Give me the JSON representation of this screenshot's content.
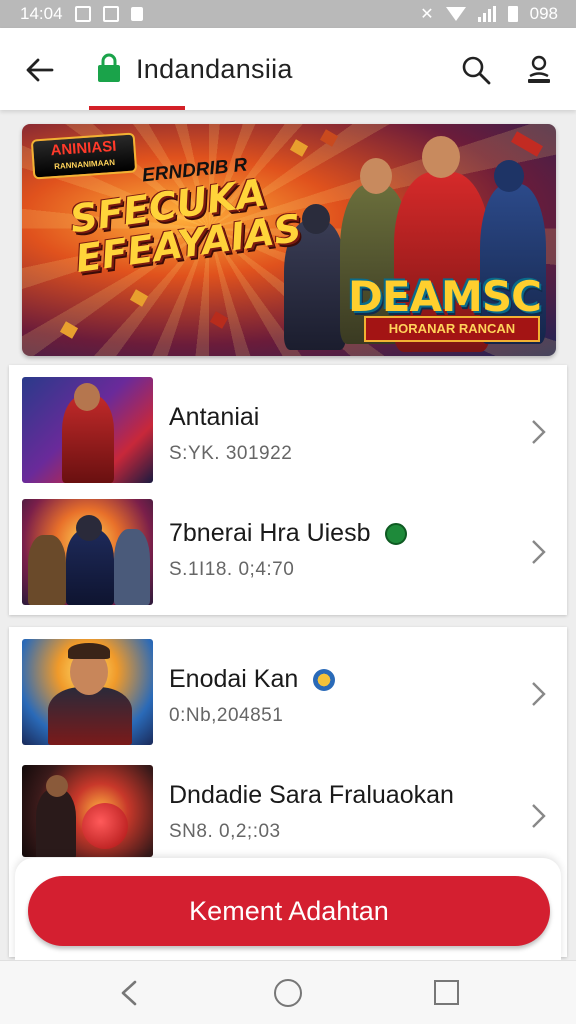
{
  "status_bar": {
    "time": "14:04",
    "battery": "098",
    "icons": [
      "sim-icon",
      "photo-icon",
      "notification-icon",
      "mute-icon",
      "wifi-icon",
      "signal-icon",
      "battery-icon"
    ]
  },
  "app_bar": {
    "title": "Indandansiia",
    "icons": [
      "back-arrow-icon",
      "lock-icon",
      "search-icon",
      "profile-icon"
    ],
    "accent_color": "#d32027",
    "lock_color": "#1aa34a"
  },
  "banner": {
    "badge": "ANINIASI",
    "badge_sub": "RANNANIMAAN",
    "kicker": "ERNDRIB R",
    "headline": "SFECUKA EFEAYAIAS",
    "logo": "DEAMSC",
    "logo_sub": "HORANAR RANCAN"
  },
  "lists": [
    {
      "items": [
        {
          "title": "Antaniai",
          "subtitle": "S:YK. 301922",
          "icon": ""
        },
        {
          "title": "7bnerai Hra Uiesb",
          "subtitle": "S.1I18. 0;4:70",
          "icon": "green-badge-icon"
        }
      ]
    },
    {
      "items": [
        {
          "title": "Enodai Kan",
          "subtitle": "0:Nb,204851",
          "icon": "coin-icon"
        },
        {
          "title": "Dndadie Sara Fraluaokan",
          "subtitle": "SN8. 0,2;:03",
          "icon": ""
        }
      ]
    }
  ],
  "cta": {
    "label": "Kement Adahtan",
    "color": "#d41f30"
  },
  "nav": {
    "icons": [
      "nav-back-icon",
      "nav-home-icon",
      "nav-recents-icon"
    ]
  }
}
